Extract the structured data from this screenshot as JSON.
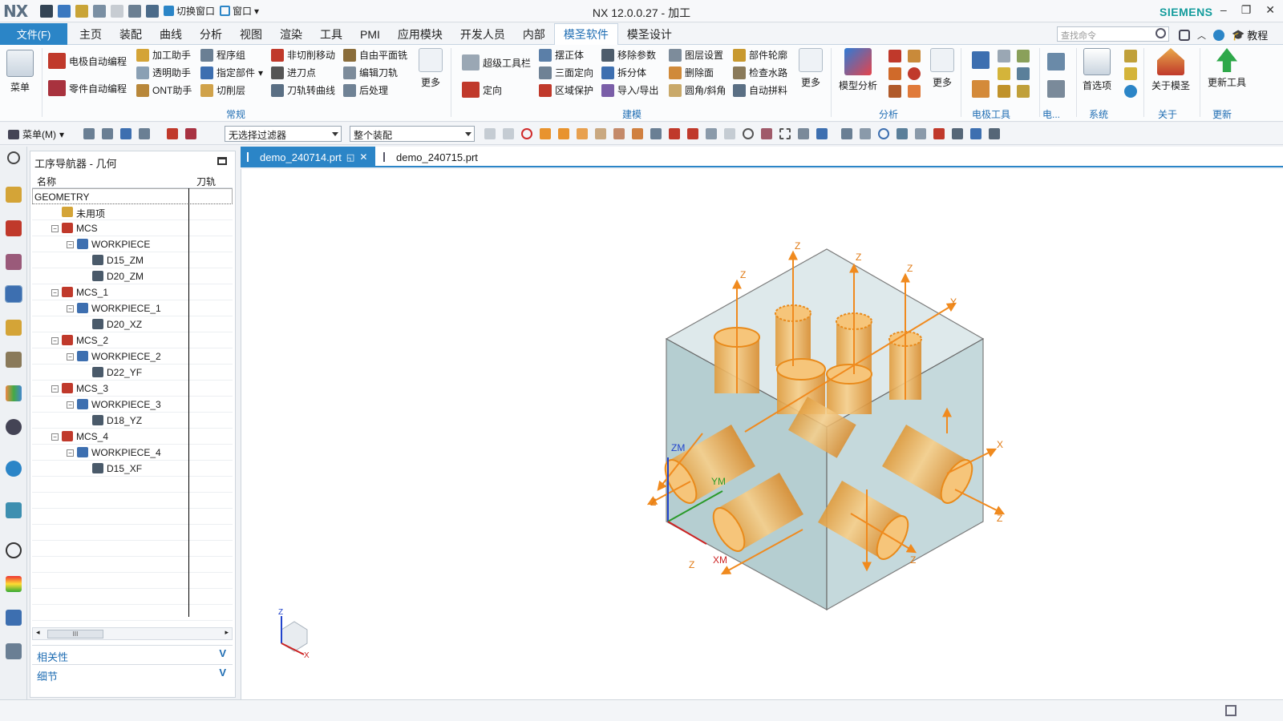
{
  "title_bar": {
    "logo": "NX",
    "quick_access": {
      "switch_window": "切换窗口",
      "window": "窗口"
    },
    "window_title": "NX 12.0.0.27 - 加工",
    "brand": "SIEMENS"
  },
  "menu": {
    "file_tab": "文件(F)",
    "tabs": [
      "主页",
      "装配",
      "曲线",
      "分析",
      "视图",
      "渲染",
      "工具",
      "PMI",
      "应用模块",
      "开发人员",
      "内部",
      "模圣软件",
      "模圣设计"
    ],
    "active_tab": "模圣软件",
    "search_placeholder": "查找命令",
    "tutorial": "教程"
  },
  "ribbon": {
    "menu_big": "菜单",
    "common": {
      "electrode_auto": "电极自动编程",
      "machining_helper": "加工助手",
      "program_group": "程序组",
      "part_auto": "零件自动编程",
      "transparent_helper": "透明助手",
      "specify_part": "指定部件",
      "ont_helper": "ONT助手",
      "cut_layer": "切削层",
      "non_cut_move": "非切削移动",
      "free_face_mill": "自由平面铣",
      "approach_point": "进刀点",
      "edit_toolpath": "编辑刀轨",
      "toolpath_to_curve": "刀轨转曲线",
      "post_process": "后处理",
      "more": "更多",
      "label": "常规"
    },
    "modeling": {
      "super_toolbar": "超级工具栏",
      "orient": "定向",
      "align_body": "摆正体",
      "three_face_orient": "三面定向",
      "region_protect": "区域保护",
      "remove_params": "移除参数",
      "split_body": "拆分体",
      "import_export": "导入/导出",
      "layer_settings": "图层设置",
      "delete_face": "删除面",
      "fillet_chamfer": "圆角/斜角",
      "part_outline": "部件轮廓",
      "check_waterway": "检查水路",
      "auto_fill": "自动拼料",
      "more": "更多",
      "label": "建模"
    },
    "analysis": {
      "model_analysis": "模型分析",
      "more": "更多",
      "label": "分析"
    },
    "electrode": {
      "label": "电极工具",
      "label2": "电..."
    },
    "system": {
      "preferences": "首选项",
      "label": "系统"
    },
    "about": {
      "about_mosheng": "关于模圣",
      "label": "关于"
    },
    "update": {
      "update_tool": "更新工具",
      "label": "更新"
    }
  },
  "selection_bar": {
    "menu_label": "菜单(M)",
    "filter_value": "无选择过滤器",
    "scope_value": "整个装配"
  },
  "navigator": {
    "title": "工序导航器 - 几何",
    "col_name": "名称",
    "col_path": "刀轨",
    "rows": [
      {
        "label": "GEOMETRY",
        "level": 0,
        "kind": "root"
      },
      {
        "label": "未用项",
        "level": 1,
        "kind": "folder"
      },
      {
        "label": "MCS",
        "level": 1,
        "kind": "mcs"
      },
      {
        "label": "WORKPIECE",
        "level": 2,
        "kind": "workpiece"
      },
      {
        "label": "D15_ZM",
        "level": 3,
        "kind": "op"
      },
      {
        "label": "D20_ZM",
        "level": 3,
        "kind": "op"
      },
      {
        "label": "MCS_1",
        "level": 1,
        "kind": "mcs"
      },
      {
        "label": "WORKPIECE_1",
        "level": 2,
        "kind": "workpiece"
      },
      {
        "label": "D20_XZ",
        "level": 3,
        "kind": "op"
      },
      {
        "label": "MCS_2",
        "level": 1,
        "kind": "mcs"
      },
      {
        "label": "WORKPIECE_2",
        "level": 2,
        "kind": "workpiece"
      },
      {
        "label": "D22_YF",
        "level": 3,
        "kind": "op"
      },
      {
        "label": "MCS_3",
        "level": 1,
        "kind": "mcs"
      },
      {
        "label": "WORKPIECE_3",
        "level": 2,
        "kind": "workpiece"
      },
      {
        "label": "D18_YZ",
        "level": 3,
        "kind": "op"
      },
      {
        "label": "MCS_4",
        "level": 1,
        "kind": "mcs"
      },
      {
        "label": "WORKPIECE_4",
        "level": 2,
        "kind": "workpiece"
      },
      {
        "label": "D15_XF",
        "level": 3,
        "kind": "op"
      }
    ],
    "panels": {
      "dependencies": "相关性",
      "details": "细节"
    }
  },
  "documents": {
    "tabs": [
      "demo_240714.prt",
      "demo_240715.prt"
    ],
    "active": "demo_240714.prt"
  },
  "viewport": {
    "axis_labels": {
      "zm": "ZM",
      "ym": "YM",
      "xm": "XM",
      "z": "Z",
      "x": "X",
      "y": "Y"
    },
    "triad": {
      "z": "Z",
      "x": "X"
    },
    "colors": {
      "block": "#8fb8bd",
      "cylinder": "#f0b45a",
      "arrow": "#f08a1e",
      "accent": "#2b85c7"
    }
  }
}
